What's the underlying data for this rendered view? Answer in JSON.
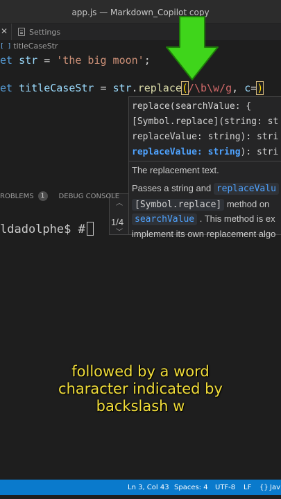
{
  "window": {
    "title": "app.js — Markdown_Copilot copy"
  },
  "tabs": {
    "close_glyph": "✕",
    "settings_label": "Settings"
  },
  "breadcrumb": {
    "symbol": "titleCaseStr"
  },
  "code": {
    "line1": {
      "keyword": "et",
      "var": "str",
      "eq": " = ",
      "string": "'the big moon'",
      "semi": ";"
    },
    "line3": {
      "keyword": "et",
      "var": "titleCaseStr",
      "eq": " = ",
      "obj": "str",
      "dot": ".",
      "method": "replace",
      "paren_open": "(",
      "regex": "/\\b\\w/g",
      "comma": ", ",
      "param": "c",
      "arrow_start": "=",
      "paren_close": ")"
    }
  },
  "hover": {
    "sig1": "replace(searchValue: {",
    "sig2": "[Symbol.replace](string: st",
    "sig3": "replaceValue: string): stri",
    "sig4_active": "replaceValue: string",
    "sig4_rest": "): stri",
    "description": "The replacement text.",
    "desc2_prefix": "Passes a string and ",
    "desc2_code": "replaceValu",
    "desc3_code": "[Symbol.replace]",
    "desc3_rest": " method on",
    "desc4_code": "searchValue",
    "desc4_rest": " . This method is ex",
    "desc5": "implement its own replacement algo",
    "overload_counter": "1/4",
    "chev_up": "︿",
    "chev_down": "﹀"
  },
  "panel": {
    "problems_label": "ROBLEMS",
    "problems_count": "1",
    "debug_label": "DEBUG CONSOLE"
  },
  "terminal": {
    "prompt": "ldadolphe$ #"
  },
  "caption": {
    "line1": "followed by a word",
    "line2": "character indicated by",
    "line3": "backslash w"
  },
  "status": {
    "position": "Ln 3, Col 43",
    "spaces": "Spaces: 4",
    "encoding": "UTF-8",
    "eol": "LF",
    "braces": "{}",
    "language": "Jav"
  },
  "colors": {
    "accent_arrow": "#3fd51b",
    "status_bar": "#0a7acc",
    "caption": "#f2de3a"
  }
}
